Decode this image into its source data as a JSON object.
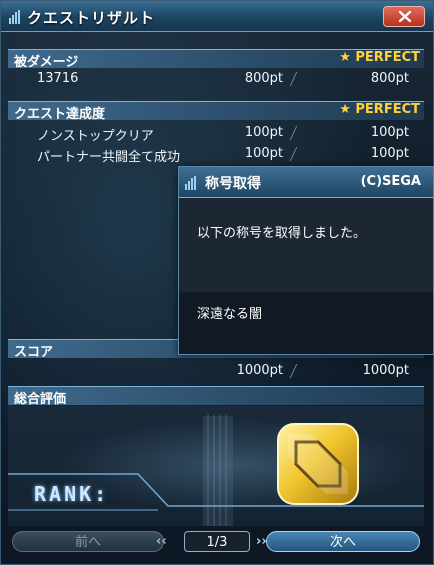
{
  "window": {
    "title": "クエストリザルト"
  },
  "sections": {
    "damage": {
      "label": "被ダメージ",
      "perfect": "★ PERFECT",
      "rows": [
        {
          "name": "13716",
          "score": "800pt",
          "max": "800pt"
        }
      ]
    },
    "achievement": {
      "label": "クエスト達成度",
      "perfect": "★ PERFECT",
      "rows": [
        {
          "name": "ノンストップクリア",
          "score": "100pt",
          "max": "100pt"
        },
        {
          "name": "パートナー共闘全て成功",
          "score": "100pt",
          "max": "100pt"
        }
      ]
    },
    "score": {
      "label": "スコア",
      "score": "1000pt",
      "max": "1000pt"
    },
    "overall": {
      "label": "総合評価",
      "rank_label": "RANK:",
      "rank_value": "S"
    }
  },
  "nav": {
    "prev": "前へ",
    "page": "1/3",
    "next": "次へ"
  },
  "popup": {
    "title": "称号取得",
    "publisher": "(C)SEGA",
    "message": "以下の称号を取得しました。",
    "item": "深遠なる闇"
  },
  "colors": {
    "accent": "#ffd23a",
    "title_bar": "#1d4461",
    "next_button": "#23557c"
  }
}
